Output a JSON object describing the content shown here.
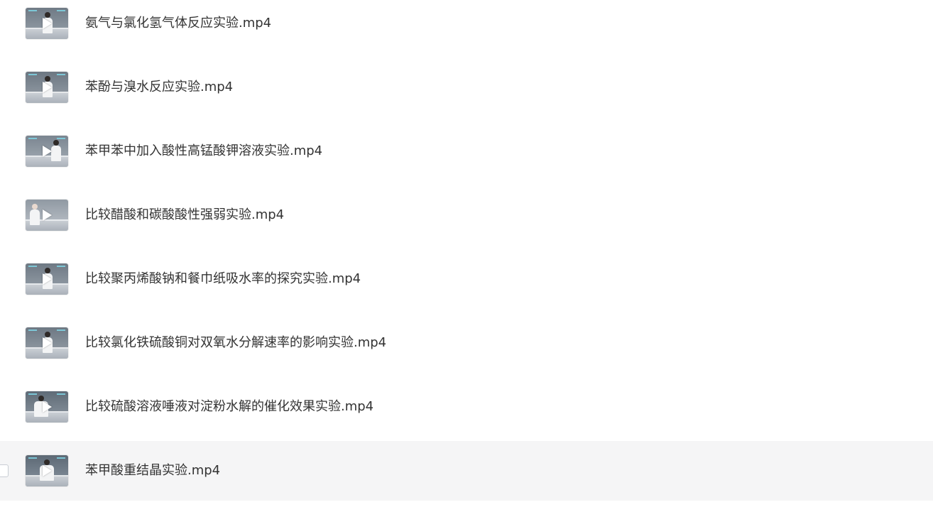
{
  "files": [
    {
      "name": "氨气与氯化氢气体反应实验.mp4",
      "thumb_icon": "video-play-icon"
    },
    {
      "name": "苯酚与溴水反应实验.mp4",
      "thumb_icon": "video-play-icon"
    },
    {
      "name": "苯甲苯中加入酸性高锰酸钾溶液实验.mp4",
      "thumb_icon": "video-play-icon"
    },
    {
      "name": "比较醋酸和碳酸酸性强弱实验.mp4",
      "thumb_icon": "video-play-icon"
    },
    {
      "name": "比较聚丙烯酸钠和餐巾纸吸水率的探究实验.mp4",
      "thumb_icon": "video-play-icon"
    },
    {
      "name": "比较氯化铁硫酸铜对双氧水分解速率的影响实验.mp4",
      "thumb_icon": "video-play-icon"
    },
    {
      "name": "比较硫酸溶液唾液对淀粉水解的催化效果实验.mp4",
      "thumb_icon": "video-play-icon"
    },
    {
      "name": "苯甲酸重结晶实验.mp4",
      "thumb_icon": "video-play-icon"
    }
  ],
  "colors": {
    "hover_row_bg": "#f5f5f6",
    "text": "#333333"
  }
}
